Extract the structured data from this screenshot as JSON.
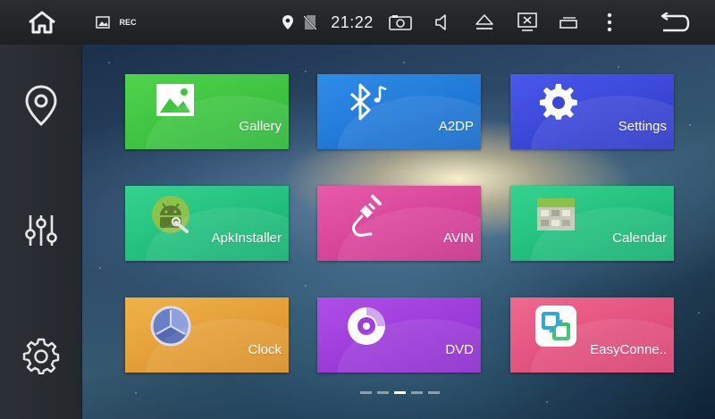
{
  "status_bar": {
    "time": "21:22",
    "rec_label": "REC",
    "icons": [
      "home-icon",
      "image-icon",
      "location-icon",
      "no-sim-icon",
      "screenshot-icon",
      "volume-icon",
      "eject-icon",
      "close-app-icon",
      "recent-apps-icon",
      "more-icon",
      "back-icon"
    ]
  },
  "sidebar": {
    "items": [
      {
        "icon": "location-pin-icon"
      },
      {
        "icon": "equalizer-icon"
      },
      {
        "icon": "settings-gear-icon"
      }
    ]
  },
  "apps": [
    {
      "label": "Gallery",
      "icon": "gallery-icon",
      "color": "#3fc63f"
    },
    {
      "label": "A2DP",
      "icon": "bluetooth-music-icon",
      "color": "#1f7bd9"
    },
    {
      "label": "Settings",
      "icon": "settings-icon",
      "color": "#3b47d9"
    },
    {
      "label": "ApkInstaller",
      "icon": "android-installer-icon",
      "color": "#22c07d"
    },
    {
      "label": "AVIN",
      "icon": "av-cable-icon",
      "color": "#d9449a"
    },
    {
      "label": "Calendar",
      "icon": "calendar-icon",
      "color": "#1fbf7d"
    },
    {
      "label": "Clock",
      "icon": "clock-icon",
      "color": "#e6a23a"
    },
    {
      "label": "DVD",
      "icon": "disc-icon",
      "color": "#9e3fdc"
    },
    {
      "label": "EasyConne..",
      "icon": "easyconnect-icon",
      "color": "#e4557f"
    }
  ],
  "pager": {
    "pages": 5,
    "current": 3
  }
}
